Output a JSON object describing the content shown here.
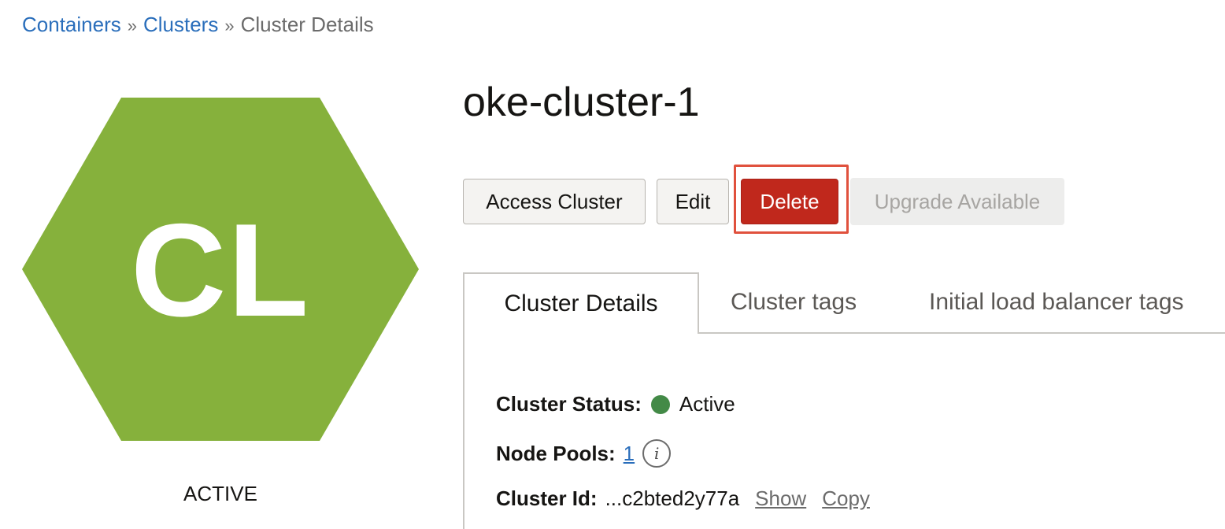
{
  "breadcrumb": {
    "items": [
      "Containers",
      "Clusters"
    ],
    "current": "Cluster Details",
    "separator": "»"
  },
  "cluster": {
    "name": "oke-cluster-1",
    "initials": "CL",
    "state": "ACTIVE",
    "hex_color": "#86b13c"
  },
  "actions": {
    "access": "Access Cluster",
    "edit": "Edit",
    "delete": "Delete",
    "upgrade": "Upgrade Available"
  },
  "tabs": {
    "details": "Cluster Details",
    "tags": "Cluster tags",
    "lb_tags": "Initial load balancer tags"
  },
  "details": {
    "status_label": "Cluster Status:",
    "status_value": "Active",
    "status_color": "#438a47",
    "pools_label": "Node Pools:",
    "pools_value": "1",
    "id_label": "Cluster Id:",
    "id_value": "...c2bted2y77a",
    "show": "Show",
    "copy": "Copy"
  }
}
